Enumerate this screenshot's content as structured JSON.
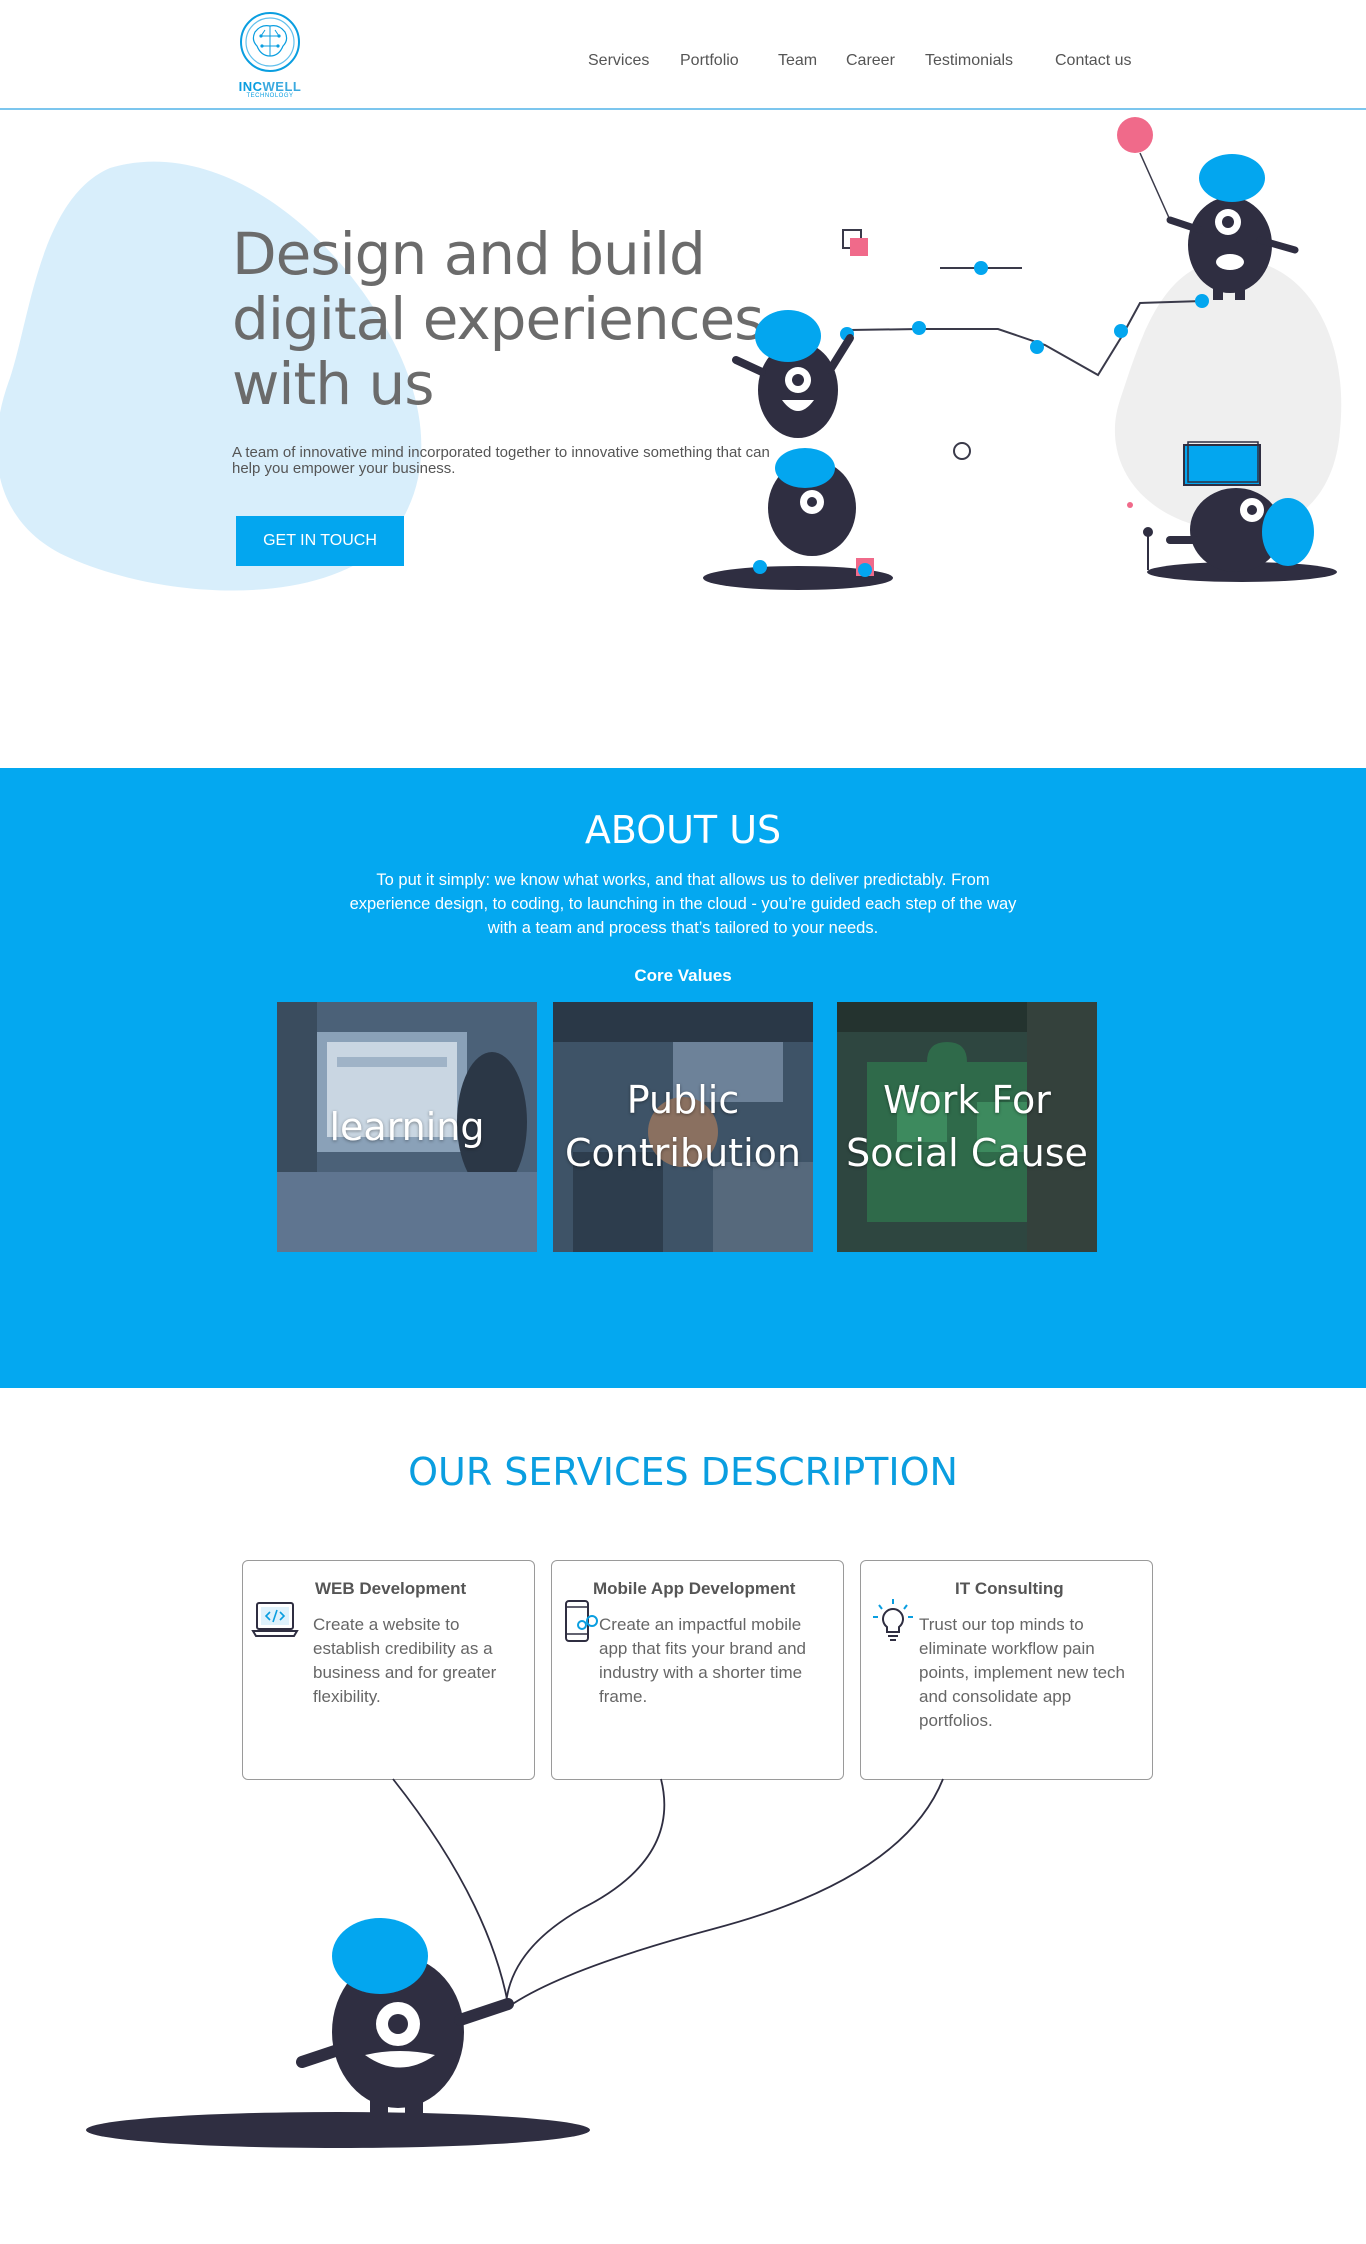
{
  "brand": {
    "name_part1": "INC",
    "name_part2": "WELL",
    "tagline": "TECHNOLOGY",
    "accent": "#03a6ef"
  },
  "nav": {
    "items": [
      {
        "label": "Services"
      },
      {
        "label": "Portfolio"
      },
      {
        "label": "Team"
      },
      {
        "label": "Career"
      },
      {
        "label": "Testimonials"
      },
      {
        "label": "Contact us"
      }
    ]
  },
  "hero": {
    "title_line1": "Design and build",
    "title_line2": "digital experiences",
    "title_line3": "with us",
    "subtitle": "A team of innovative mind incorporated together to innovative something that can help you empower your business.",
    "cta": "GET IN TOUCH"
  },
  "about": {
    "title": "ABOUT US",
    "text": "To put it simply: we know what works, and that allows us to deliver predictably. From experience design, to coding, to launching in the cloud - you’re guided each step of the way with a team and process that’s tailored to your needs.",
    "core_values_label": "Core Values",
    "values": [
      {
        "line1": "learning",
        "line2": ""
      },
      {
        "line1": "Public",
        "line2": "Contribution"
      },
      {
        "line1": "Work For",
        "line2": "Social Cause"
      }
    ],
    "background": "#04a8f0"
  },
  "services": {
    "title": "OUR SERVICES DESCRIPTION",
    "items": [
      {
        "title": "WEB Development",
        "icon": "laptop-code-icon",
        "desc": "Create a website to establish credibility as a business and for greater flexibility."
      },
      {
        "title": "Mobile App Development",
        "icon": "mobile-gear-icon",
        "desc": "Create an impactful mobile app that fits your brand and industry with a shorter time frame."
      },
      {
        "title": "IT Consulting",
        "icon": "lightbulb-icon",
        "desc": "Trust our top minds to eliminate workflow pain points, implement new tech and consolidate app portfolios."
      }
    ]
  }
}
